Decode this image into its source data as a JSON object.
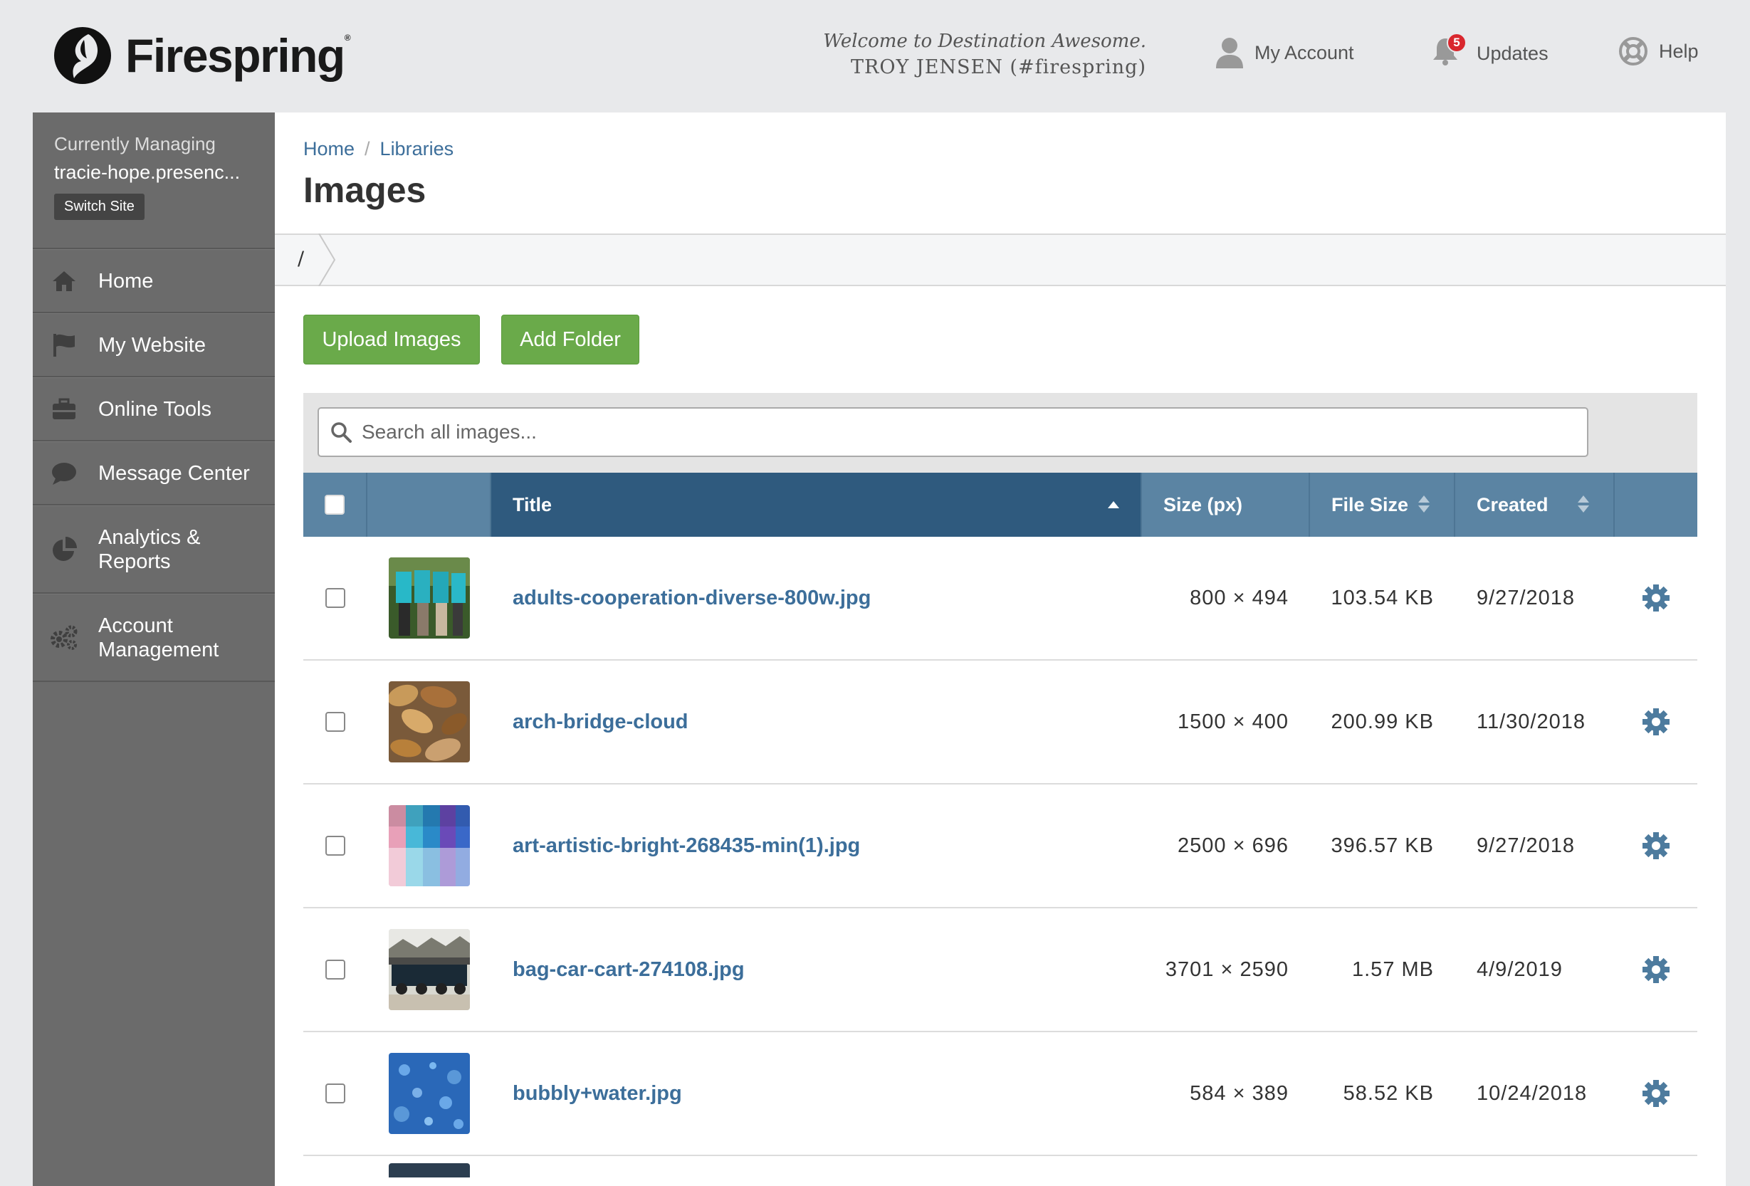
{
  "header": {
    "logo_text": "Firespring",
    "welcome_line": "Welcome to Destination Awesome.",
    "user_line": "TROY JENSEN (#firespring)",
    "account_label": "My Account",
    "updates_label": "Updates",
    "updates_count": "5",
    "help_label": "Help"
  },
  "sidebar": {
    "managing_label": "Currently Managing",
    "managing_site": "tracie-hope.presenc...",
    "switch_label": "Switch Site",
    "items": [
      {
        "label": "Home",
        "icon": "home-icon"
      },
      {
        "label": "My Website",
        "icon": "flag-icon"
      },
      {
        "label": "Online Tools",
        "icon": "toolbox-icon"
      },
      {
        "label": "Message Center",
        "icon": "chat-bubble-icon"
      },
      {
        "label": "Analytics & Reports",
        "icon": "pie-chart-icon"
      },
      {
        "label": "Account Management",
        "icon": "gears-icon"
      }
    ]
  },
  "breadcrumb": {
    "home": "Home",
    "separator": "/",
    "libraries": "Libraries"
  },
  "page_title": "Images",
  "path": {
    "root": "/"
  },
  "buttons": {
    "upload": "Upload Images",
    "add_folder": "Add Folder"
  },
  "search": {
    "placeholder": "Search all images..."
  },
  "table": {
    "headers": {
      "title": "Title",
      "size": "Size (px)",
      "file_size": "File Size",
      "created": "Created"
    },
    "rows": [
      {
        "title": "adults-cooperation-diverse-800w.jpg",
        "size": "800 × 494",
        "file_size": "103.54 KB",
        "created": "9/27/2018"
      },
      {
        "title": "arch-bridge-cloud",
        "size": "1500 × 400",
        "file_size": "200.99 KB",
        "created": "11/30/2018"
      },
      {
        "title": "art-artistic-bright-268435-min(1).jpg",
        "size": "2500 × 696",
        "file_size": "396.57 KB",
        "created": "9/27/2018"
      },
      {
        "title": "bag-car-cart-274108.jpg",
        "size": "3701 × 2590",
        "file_size": "1.57 MB",
        "created": "4/9/2019"
      },
      {
        "title": "bubbly+water.jpg",
        "size": "584 × 389",
        "file_size": "58.52 KB",
        "created": "10/24/2018"
      }
    ]
  },
  "colors": {
    "accent_blue": "#3c6e9a",
    "header_blue": "#5b84a3",
    "header_active": "#2f5a7e",
    "button_green": "#6aaa4a",
    "sidebar_gray": "#6b6b6b",
    "badge_red": "#d9272e"
  }
}
